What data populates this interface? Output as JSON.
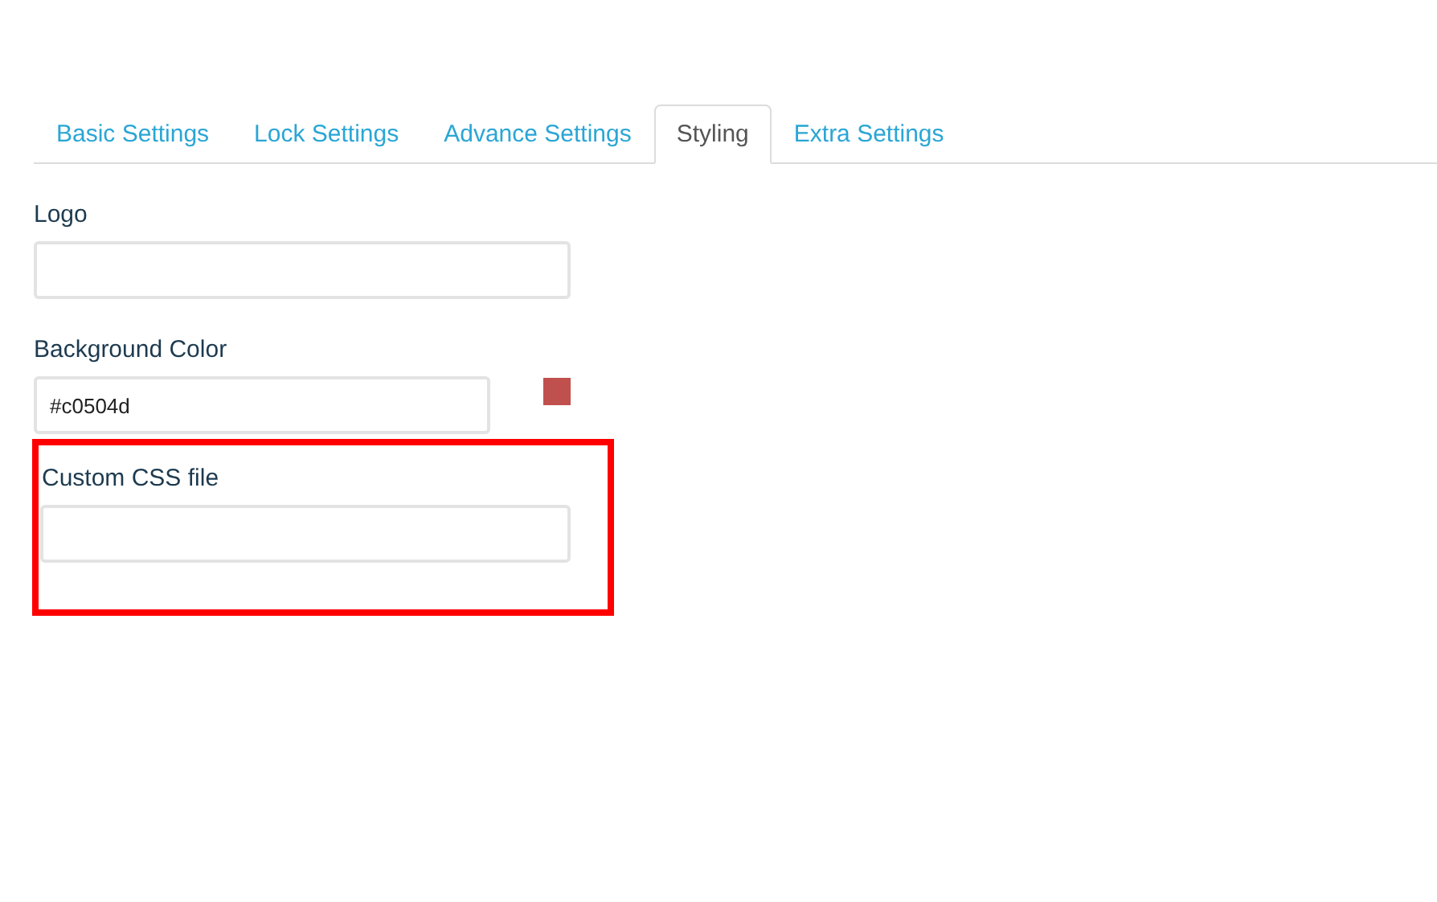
{
  "tabs": [
    {
      "label": "Basic Settings",
      "selected": false
    },
    {
      "label": "Lock Settings",
      "selected": false
    },
    {
      "label": "Advance Settings",
      "selected": false
    },
    {
      "label": "Styling",
      "selected": true
    },
    {
      "label": "Extra Settings",
      "selected": false
    }
  ],
  "fields": [
    {
      "kind": "text",
      "label": "Logo",
      "highlighted": false
    },
    {
      "kind": "color",
      "label": "Background Color",
      "value": "#c0504d",
      "color": "#c0504d",
      "highlighted": false
    },
    {
      "kind": "text",
      "label": "Custom CSS file",
      "highlighted": true
    }
  ]
}
